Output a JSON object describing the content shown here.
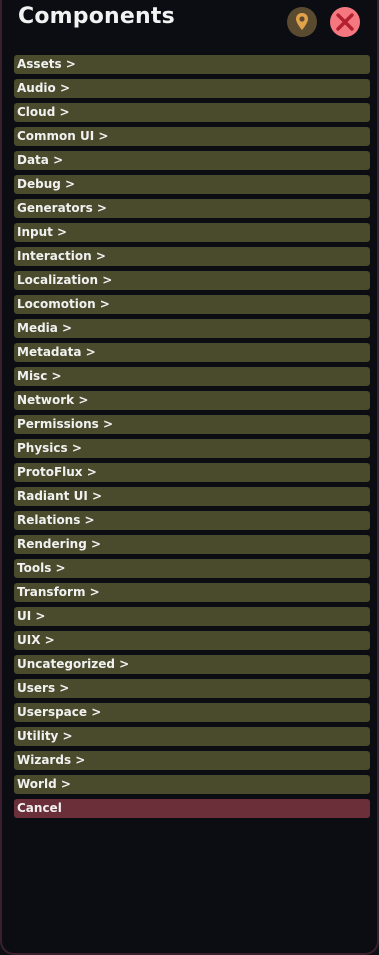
{
  "header": {
    "title": "Components",
    "pin_icon": "pin-icon",
    "close_icon": "close-icon"
  },
  "colors": {
    "item_bg": "#4a4a2c",
    "cancel_bg": "#6b2f3a",
    "pin_bg": "#5a4a30",
    "close_bg": "#f5777f",
    "panel_bg": "#0b0d12"
  },
  "categories": [
    "Assets >",
    "Audio >",
    "Cloud >",
    "Common UI >",
    "Data >",
    "Debug >",
    "Generators >",
    "Input >",
    "Interaction >",
    "Localization >",
    "Locomotion >",
    "Media >",
    "Metadata >",
    "Misc >",
    "Network >",
    "Permissions >",
    "Physics >",
    "ProtoFlux >",
    "Radiant UI >",
    "Relations >",
    "Rendering >",
    "Tools >",
    "Transform >",
    "UI >",
    "UIX >",
    "Uncategorized >",
    "Users >",
    "Userspace >",
    "Utility >",
    "Wizards >",
    "World >"
  ],
  "cancel_label": "Cancel"
}
